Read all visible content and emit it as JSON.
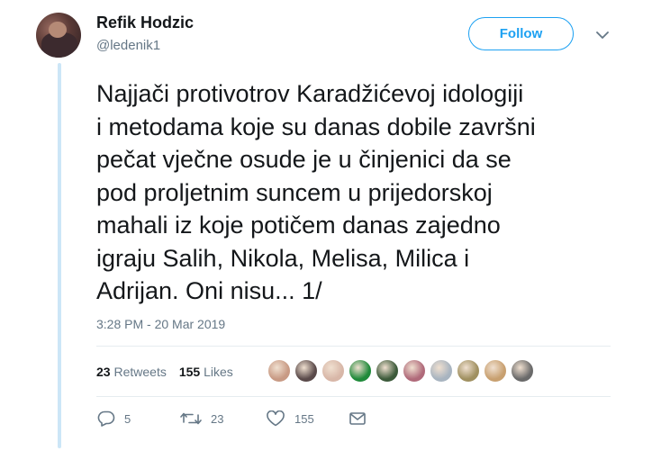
{
  "user": {
    "name": "Refik Hodzic",
    "handle": "@ledenik1"
  },
  "follow_label": "Follow",
  "tweet": {
    "text": "Najjači protivotrov Karadžićevoj idologiji\ni metodama koje su danas dobile završni\npečat vječne osude je u činjenici da se\npod proljetnim suncem u prijedorskoj\nmahali iz koje potičem danas zajedno\nigraju Salih, Nikola, Melisa, Milica i\nAdrijan. Oni nisu... 1/",
    "timestamp": "3:28 PM - 20 Mar 2019"
  },
  "stats": {
    "retweets_count": "23",
    "retweets_label": "Retweets",
    "likes_count": "155",
    "likes_label": "Likes"
  },
  "likers": [
    {
      "color": "#c89a84"
    },
    {
      "color": "#5a4a4a"
    },
    {
      "color": "#d8b7a8"
    },
    {
      "color": "#1f8a3a"
    },
    {
      "color": "#3c5a3a"
    },
    {
      "color": "#b06a7a"
    },
    {
      "color": "#a8b4c0"
    },
    {
      "color": "#a09060"
    },
    {
      "color": "#c8a070"
    },
    {
      "color": "#6a6a6a"
    }
  ],
  "actions": {
    "replies": "5",
    "retweets": "23",
    "likes": "155"
  },
  "colors": {
    "accent": "#1da1f2",
    "text": "#14171a",
    "muted": "#657786",
    "thread": "#cce6f7"
  }
}
